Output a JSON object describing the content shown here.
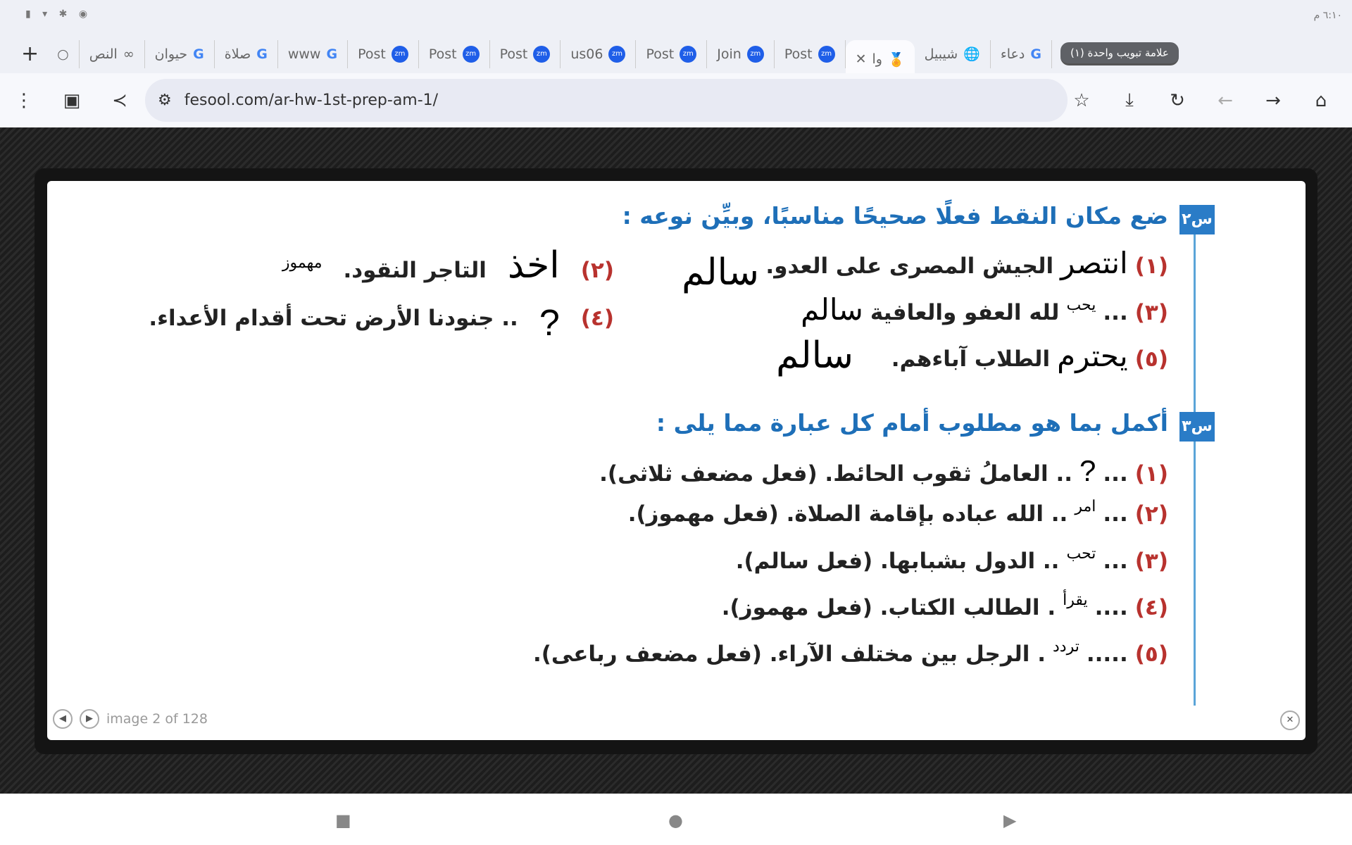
{
  "status_bar": {
    "icons": "▮ ▾ ✱ ◉",
    "time": "٦:١٠ م"
  },
  "tabs": [
    {
      "label": "",
      "icon": "plus-icon"
    },
    {
      "label": "",
      "icon": "circle-icon"
    },
    {
      "label": "النص",
      "icon": "infinity-icon"
    },
    {
      "label": "حيوان",
      "icon": "google-icon"
    },
    {
      "label": "صلاة",
      "icon": "google-icon"
    },
    {
      "label": "www",
      "icon": "google-icon"
    },
    {
      "label": "Post",
      "icon": "zoom-icon"
    },
    {
      "label": "Post",
      "icon": "zoom-icon"
    },
    {
      "label": "Post",
      "icon": "zoom-icon"
    },
    {
      "label": "us06",
      "icon": "zoom-icon"
    },
    {
      "label": "Post",
      "icon": "zoom-icon"
    },
    {
      "label": "Join",
      "icon": "zoom-icon"
    },
    {
      "label": "Post",
      "icon": "zoom-icon"
    },
    {
      "label": "وا",
      "icon": "trophy-icon",
      "active": true
    },
    {
      "label": "شيبيل",
      "icon": "globe-icon"
    },
    {
      "label": "دعاء",
      "icon": "google-icon"
    }
  ],
  "tab_group_label": "علامة تبويب واحدة (١)",
  "zm": "zm",
  "g": "G",
  "address": {
    "url": "fesool.com/ar-hw-1st-prep-am-1/"
  },
  "q2": {
    "badge": "س٢",
    "heading": "ضع مكان النقط فعلًا صحيحًا مناسبًا، وبيِّن نوعه :",
    "items": [
      {
        "num": "(١)",
        "answer": "انتصر",
        "text": "الجيش المصرى على العدو.",
        "type": "سالم"
      },
      {
        "num": "(٢)",
        "answer": "اخذ",
        "text": "التاجر النقود.",
        "type": "مهموز"
      },
      {
        "num": "(٣)",
        "dots": "...",
        "answer": "يحب",
        "text": "لله العفو والعافية",
        "type": "سالم"
      },
      {
        "num": "(٤)",
        "answer": "?",
        "text": ".. جنودنا الأرض تحت أقدام الأعداء."
      },
      {
        "num": "(٥)",
        "answer": "يحترم",
        "text": "الطلاب آباءهم.",
        "type": "سالم"
      }
    ]
  },
  "q3": {
    "badge": "س٣",
    "heading": "أكمل بما هو مطلوب أمام كل عبارة مما يلى :",
    "items": [
      {
        "num": "(١)",
        "dots": "...",
        "answer": "?",
        "text": ".. العاملُ ثقوب الحائط. (فعل مضعف ثلاثى)."
      },
      {
        "num": "(٢)",
        "dots": "...",
        "answer": "امر",
        "text": ".. الله عباده بإقامة الصلاة. (فعل مهموز)."
      },
      {
        "num": "(٣)",
        "dots": "...",
        "answer": "تحب",
        "text": ".. الدول بشبابها. (فعل سالم)."
      },
      {
        "num": "(٤)",
        "dots": "....",
        "answer": "يقرأ",
        "text": ". الطالب الكتاب. (فعل مهموز)."
      },
      {
        "num": "(٥)",
        "dots": ".....",
        "answer": "تردد",
        "text": ". الرجل بين مختلف الآراء. (فعل مضعف رباعى)."
      }
    ]
  },
  "viewer": {
    "counter": "image 2 of 128"
  }
}
